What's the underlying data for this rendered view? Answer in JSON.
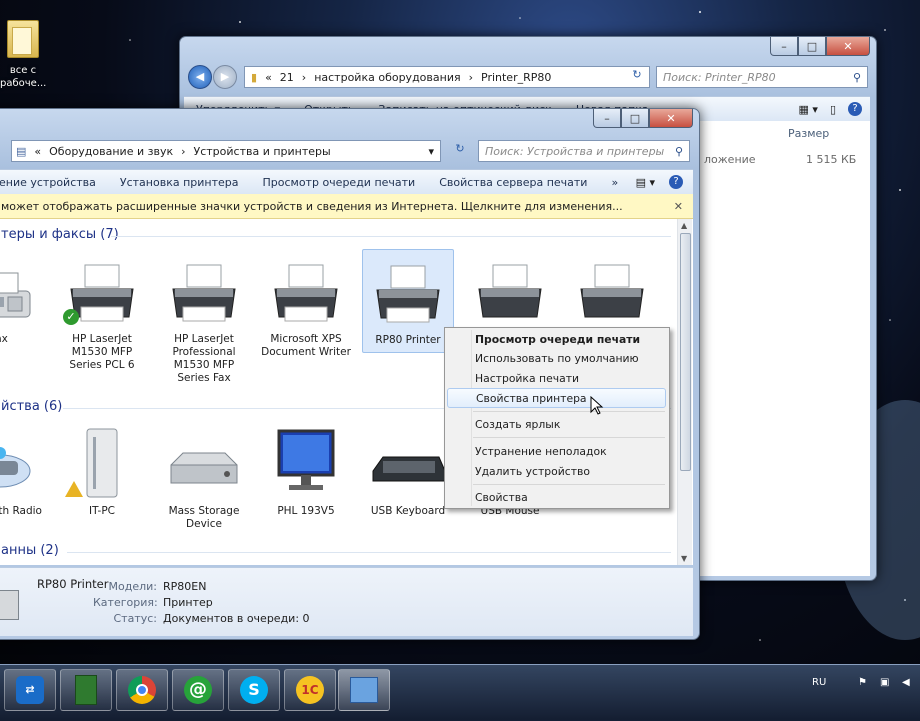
{
  "desktop": {
    "icon_label": "все с рабочe..."
  },
  "back_window": {
    "address_parts": [
      "«",
      "21",
      "›",
      "настройка оборудования",
      "›",
      "Printer_RP80"
    ],
    "search_placeholder": "Поиск: Printer_RP80",
    "toolbar": [
      "Упорядочить ▾",
      "Открыть",
      "Записать на оптический диск",
      "Новая папка"
    ],
    "column_size": "Размер",
    "row_type": "ложение",
    "row_size": "1 515 КБ"
  },
  "front_window": {
    "address_parts": [
      "«",
      "Оборудование и звук",
      "›",
      "Устройства и принтеры"
    ],
    "search_placeholder": "Поиск: Устройства и принтеры",
    "toolbar": [
      "ение устройства",
      "Установка принтера",
      "Просмотр очереди печати",
      "Свойства сервера печати",
      "»"
    ],
    "infobar_text": "может отображать расширенные значки устройств и сведения из Интернета.  Щелкните для изменения...",
    "groups": {
      "printers": "теры и факсы (7)",
      "devices": "йства (6)",
      "unspecified": "анны (2)"
    },
    "printers": [
      {
        "label": "Fax"
      },
      {
        "label": "HP LaserJet M1530 MFP Series PCL 6"
      },
      {
        "label": "HP LaserJet Professional M1530 MFP Series Fax"
      },
      {
        "label": "Microsoft XPS Document Writer"
      },
      {
        "label": "RP80 Printer"
      }
    ],
    "devices": [
      {
        "label": "eneric oth Radio"
      },
      {
        "label": "IT-PC"
      },
      {
        "label": "Mass Storage Device"
      },
      {
        "label": "PHL 193V5"
      },
      {
        "label": "USB Keyboard"
      },
      {
        "label": "USB Mouse"
      }
    ],
    "details": {
      "name": "RP80 Printer",
      "model_label": "Модели:",
      "model_value": "RP80EN",
      "category_label": "Категория:",
      "category_value": "Принтер",
      "status_label": "Статус:",
      "status_value": "Документов в очереди: 0"
    }
  },
  "context_menu": {
    "items": [
      "Просмотр очереди печати",
      "Использовать по умолчанию",
      "Настройка печати",
      "Свойства принтера",
      "Создать ярлык",
      "Устранение неполадок",
      "Удалить устройство",
      "Свойства"
    ]
  },
  "taskbar": {
    "language": "RU"
  },
  "colors": {
    "accent": "#1e3287",
    "infobar": "#fff8c4",
    "menu_hover": "#e2eefc"
  }
}
